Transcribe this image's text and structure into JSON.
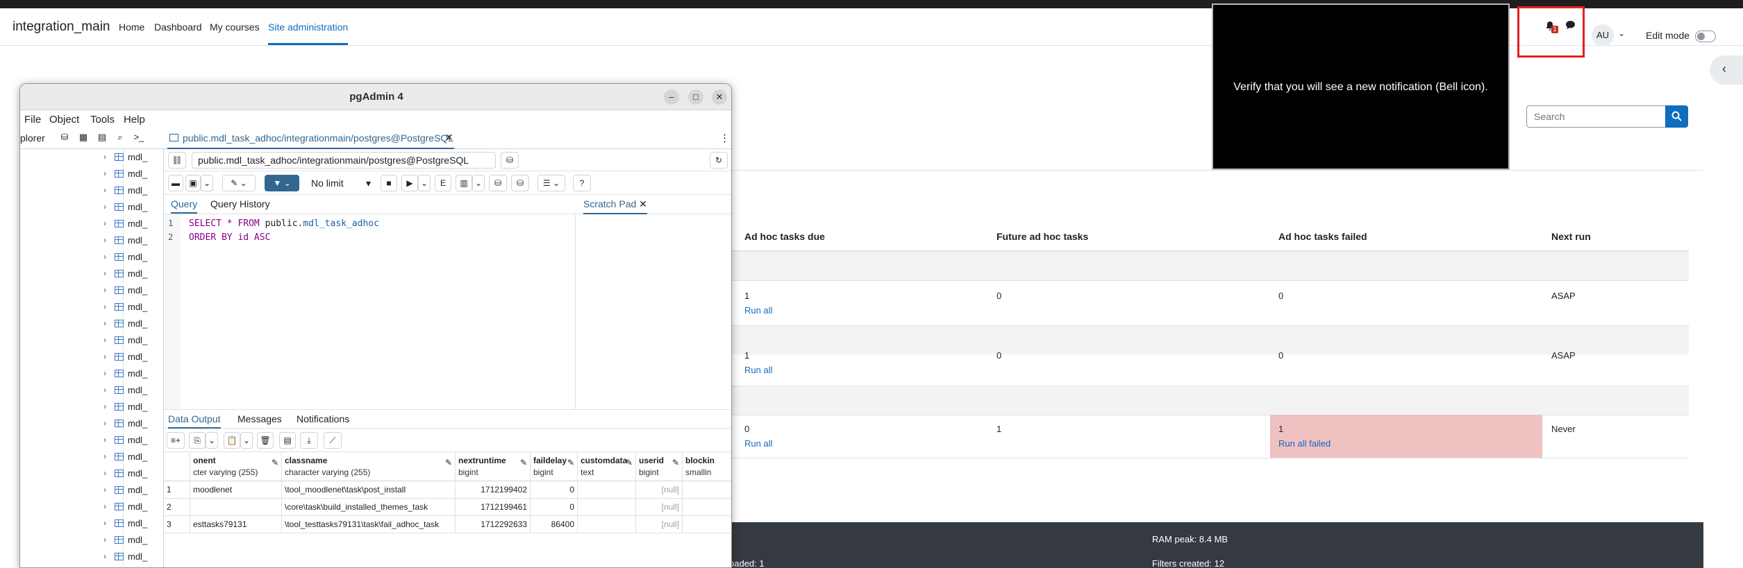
{
  "moodle": {
    "brand": "integration_main",
    "nav": [
      "Home",
      "Dashboard",
      "My courses",
      "Site administration"
    ],
    "notification_count": "1",
    "avatar_initials": "AU",
    "edit_mode_label": "Edit mode",
    "search_placeholder": "Search",
    "table_headers": [
      "Ad hoc tasks due",
      "Future ad hoc tasks",
      "Ad hoc tasks failed",
      "Next run"
    ],
    "rows": [
      {
        "due": "1",
        "due_link": "Run all",
        "future": "0",
        "failed": "0",
        "failed_link": "",
        "next_run": "ASAP"
      },
      {
        "due": "1",
        "due_link": "Run all",
        "future": "0",
        "failed": "0",
        "failed_link": "",
        "next_run": "ASAP"
      },
      {
        "due": "0",
        "due_link": "Run all",
        "future": "1",
        "failed": "1",
        "failed_link": "Run all failed",
        "next_run": "Never"
      }
    ],
    "footer": {
      "ram_peak": "RAM peak: 8.4 MB",
      "loaded": "oaded: 1",
      "filters_created": "Filters created: 12"
    },
    "overlay_text": "Verify that you will see a new notification (Bell icon).",
    "colors": {
      "accent": "#0f6cbf",
      "failed_bg": "#f0c1c1",
      "footer_bg": "#343a40",
      "highlight_box": "#e02020"
    }
  },
  "pgadmin": {
    "window_title": "pgAdmin 4",
    "menu": [
      "File",
      "Object",
      "Tools",
      "Help"
    ],
    "explorer_label": "plorer",
    "tree_items": [
      "mdl_",
      "mdl_",
      "mdl_",
      "mdl_",
      "mdl_",
      "mdl_",
      "mdl_",
      "mdl_",
      "mdl_",
      "mdl_",
      "mdl_",
      "mdl_",
      "mdl_",
      "mdl_",
      "mdl_",
      "mdl_",
      "mdl_",
      "mdl_",
      "mdl_",
      "mdl_",
      "mdl_",
      "mdl_",
      "mdl_",
      "mdl_",
      "mdl_"
    ],
    "tab_title": "public.mdl_task_adhoc/integrationmain/postgres@PostgreSQL",
    "connection": "public.mdl_task_adhoc/integrationmain/postgres@PostgreSQL",
    "row_limit": "No limit",
    "query_tabs": [
      "Query",
      "Query History"
    ],
    "scratch_pad": "Scratch Pad",
    "sql_lines": [
      {
        "num": "1",
        "kw1": "SELECT * FROM ",
        "schema": "public.",
        "obj": "mdl_task_adhoc"
      },
      {
        "num": "2",
        "kw1": "ORDER BY ",
        "col": "id",
        "kw2": " ASC"
      }
    ],
    "result_tabs": [
      "Data Output",
      "Messages",
      "Notifications"
    ],
    "columns": [
      {
        "name": "onent",
        "type": "cter varying (255)"
      },
      {
        "name": "classname",
        "type": "character varying (255)"
      },
      {
        "name": "nextruntime",
        "type": "bigint"
      },
      {
        "name": "faildelay",
        "type": "bigint"
      },
      {
        "name": "customdata",
        "type": "text"
      },
      {
        "name": "userid",
        "type": "bigint"
      },
      {
        "name": "blockin",
        "type": "smallin"
      }
    ],
    "rows": [
      {
        "n": "1",
        "component": "moodlenet",
        "classname": "\\tool_moodlenet\\task\\post_install",
        "nextruntime": "1712199402",
        "faildelay": "0",
        "customdata": "",
        "userid": "[null]"
      },
      {
        "n": "2",
        "component": "",
        "classname": "\\core\\task\\build_installed_themes_task",
        "nextruntime": "1712199461",
        "faildelay": "0",
        "customdata": "",
        "userid": "[null]"
      },
      {
        "n": "3",
        "component": "esttasks79131",
        "classname": "\\tool_testtasks79131\\task\\fail_adhoc_task",
        "nextruntime": "1712292633",
        "faildelay": "86400",
        "customdata": "",
        "userid": "[null]"
      }
    ]
  }
}
